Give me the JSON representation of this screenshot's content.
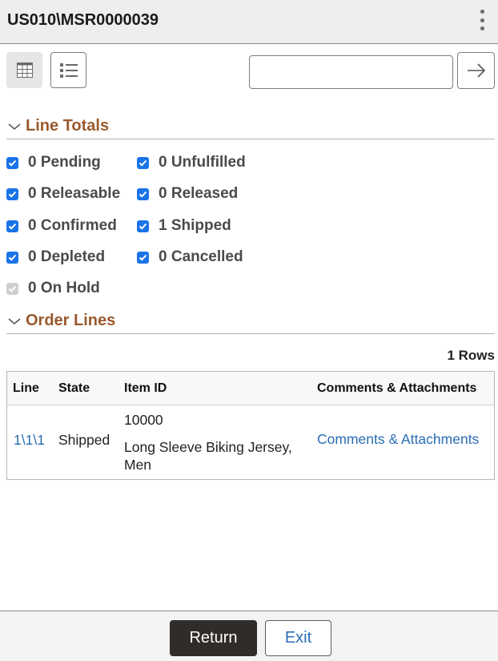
{
  "header": {
    "title": "US010\\MSR0000039",
    "menu_icon": "kebab-menu-icon"
  },
  "toolbar": {
    "grid_view_icon": "grid-icon",
    "list_view_icon": "list-icon",
    "search_value": "",
    "search_placeholder": "",
    "go_icon": "arrow-right-icon"
  },
  "line_totals": {
    "title": "Line Totals",
    "items": [
      {
        "label": "0 Pending",
        "checked": true,
        "disabled": false
      },
      {
        "label": "0 Unfulfilled",
        "checked": true,
        "disabled": false
      },
      {
        "label": "0 Releasable",
        "checked": true,
        "disabled": false
      },
      {
        "label": "0 Released",
        "checked": true,
        "disabled": false
      },
      {
        "label": "0 Confirmed",
        "checked": true,
        "disabled": false
      },
      {
        "label": "1 Shipped",
        "checked": true,
        "disabled": false
      },
      {
        "label": "0 Depleted",
        "checked": true,
        "disabled": false
      },
      {
        "label": "0 Cancelled",
        "checked": true,
        "disabled": false
      },
      {
        "label": "0 On Hold",
        "checked": true,
        "disabled": true
      }
    ]
  },
  "order_lines": {
    "title": "Order Lines",
    "rows_count": "1 Rows",
    "columns": [
      "Line",
      "State",
      "Item ID",
      "Comments & Attachments"
    ],
    "rows": [
      {
        "line": "1\\1\\1",
        "state": "Shipped",
        "item_id": "10000",
        "item_desc": "Long Sleeve Biking Jersey, Men",
        "comments_link": "Comments & Attachments"
      }
    ]
  },
  "footer": {
    "return_label": "Return",
    "exit_label": "Exit"
  },
  "colors": {
    "section_title": "#9a5a2d",
    "checkbox": "#1a73e8",
    "link": "#2a6db5",
    "primary_button": "#302c2a"
  }
}
